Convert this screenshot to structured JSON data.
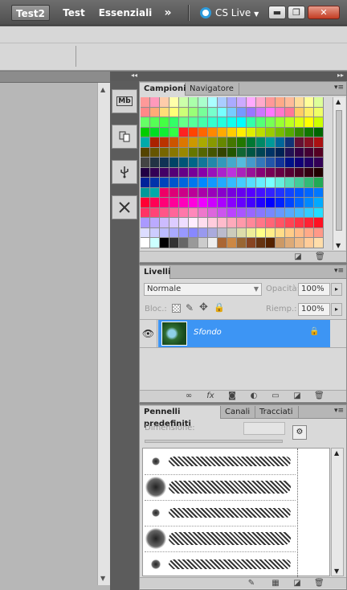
{
  "workspace_tabs": [
    "Test2",
    "Test",
    "Essenziali"
  ],
  "more_workspaces_glyph": "»",
  "cslive": {
    "label": "CS Live",
    "icon": "cs-live-ring-icon"
  },
  "window_buttons": {
    "minimize": "▬",
    "restore": "❐",
    "close": "✕"
  },
  "dock_collapse_glyph": "◂◂",
  "swatches_panel": {
    "tabs": [
      "Campioni",
      "Navigatore"
    ],
    "menu_glyph": "▾≡",
    "colors": [
      [
        "#ff9999",
        "#ff99bb",
        "#ffccaa",
        "#ffffaa",
        "#ccffaa",
        "#aaffaa",
        "#aaffcc",
        "#aaffff",
        "#aaccff",
        "#aaaaff",
        "#ccaaff",
        "#ffaaff",
        "#ffaacc",
        "#ff9999",
        "#ffaa88",
        "#ffbb99",
        "#ffdd99",
        "#ffff99",
        "#ddff99"
      ],
      [
        "#ff8888",
        "#ffaa77",
        "#ffdd77",
        "#ffff77",
        "#ccff77",
        "#99ff77",
        "#77ff99",
        "#77ffcc",
        "#77ffff",
        "#77ccff",
        "#7799ff",
        "#9977ff",
        "#cc77ff",
        "#ff77ff",
        "#ff77cc",
        "#ff7799",
        "#ffcc66",
        "#ffee66",
        "#eeff66"
      ],
      [
        "#66ff66",
        "#55ff55",
        "#44ff44",
        "#33ff66",
        "#66ff88",
        "#55ff99",
        "#44ffaa",
        "#33ffcc",
        "#22ffdd",
        "#11ffee",
        "#00ffff",
        "#33ffaa",
        "#55ff77",
        "#77ff55",
        "#99ff33",
        "#bbff22",
        "#ddff11",
        "#ffff00",
        "#ccff00"
      ],
      [
        "#00cc00",
        "#00dd22",
        "#11ee33",
        "#33ff44",
        "#ff2222",
        "#ff4400",
        "#ff6600",
        "#ff8800",
        "#ffaa00",
        "#ffcc00",
        "#ffee00",
        "#ddee00",
        "#bbdd00",
        "#99cc00",
        "#77bb00",
        "#55aa00",
        "#338800",
        "#117700",
        "#006600"
      ],
      [
        "#00aaaa",
        "#aa2200",
        "#bb3300",
        "#cc5500",
        "#dd7700",
        "#cc9900",
        "#aaaa00",
        "#889900",
        "#668800",
        "#447700",
        "#227700",
        "#007733",
        "#008866",
        "#009999",
        "#006699",
        "#113377",
        "#661133",
        "#881122",
        "#aa1111"
      ],
      [
        "#554400",
        "#665500",
        "#776600",
        "#887700",
        "#998800",
        "#667700",
        "#556600",
        "#445500",
        "#334400",
        "#225500",
        "#116633",
        "#005544",
        "#004455",
        "#003366",
        "#002255",
        "#221155",
        "#330044",
        "#440033",
        "#550022"
      ],
      [
        "#444444",
        "#223344",
        "#113355",
        "#004466",
        "#005577",
        "#006688",
        "#117799",
        "#2288aa",
        "#3399bb",
        "#44aacc",
        "#55bbdd",
        "#4499cc",
        "#3377bb",
        "#2255aa",
        "#113399",
        "#001188",
        "#110077",
        "#220066",
        "#330055"
      ],
      [
        "#220044",
        "#330055",
        "#440066",
        "#550077",
        "#660088",
        "#770099",
        "#8800aa",
        "#9911bb",
        "#aa22cc",
        "#bb33dd",
        "#aa22bb",
        "#991199",
        "#880077",
        "#770055",
        "#660044",
        "#550033",
        "#440022",
        "#330011",
        "#220000"
      ],
      [
        "#002299",
        "#0033aa",
        "#0044bb",
        "#0055cc",
        "#0066dd",
        "#0077ee",
        "#0088ff",
        "#1199ff",
        "#22aaff",
        "#33bbff",
        "#44ccff",
        "#55ddff",
        "#66eeff",
        "#77ffff",
        "#66eedd",
        "#55ddbb",
        "#44cc99",
        "#33bb77",
        "#22aa55"
      ],
      [
        "#009999",
        "#00aaaa",
        "#ee0066",
        "#dd0077",
        "#cc0088",
        "#bb0099",
        "#aa00aa",
        "#9900bb",
        "#8800cc",
        "#7700dd",
        "#6600ee",
        "#5500ff",
        "#4411ff",
        "#3322ff",
        "#2233ff",
        "#1144ff",
        "#0055ff",
        "#0066ff",
        "#0077ff"
      ],
      [
        "#ff0033",
        "#ff0055",
        "#ff0077",
        "#ff0099",
        "#ff00bb",
        "#ff00dd",
        "#ee00ff",
        "#cc00ff",
        "#aa00ff",
        "#8800ff",
        "#6600ff",
        "#4400ff",
        "#2200ff",
        "#0000ff",
        "#0022ff",
        "#0044ff",
        "#0066ff",
        "#0088ff",
        "#00aaff"
      ],
      [
        "#ff3366",
        "#ff4477",
        "#ff5588",
        "#ff6699",
        "#ff77aa",
        "#ff88bb",
        "#ee77cc",
        "#dd66dd",
        "#cc55ee",
        "#bb44ff",
        "#aa55ff",
        "#9966ff",
        "#8877ff",
        "#7788ff",
        "#6699ff",
        "#55aaff",
        "#44bbff",
        "#33ccff",
        "#22ddff"
      ],
      [
        "#aa99ff",
        "#bbaaff",
        "#ccbbff",
        "#ddccff",
        "#eeddff",
        "#ffeeff",
        "#ffddee",
        "#ffccdd",
        "#ffbbcc",
        "#ffaabb",
        "#ff99aa",
        "#ff8899",
        "#ff7788",
        "#ff6677",
        "#ff5566",
        "#ff4455",
        "#ff3344",
        "#ff2233",
        "#ff1122"
      ],
      [
        "#ddddff",
        "#ccccff",
        "#bbbbff",
        "#aaaaff",
        "#9999ff",
        "#8888ff",
        "#9999ee",
        "#aaaadd",
        "#bbbbcc",
        "#ccccbb",
        "#ddddaa",
        "#eeee99",
        "#ffff88",
        "#ffee88",
        "#ffdd88",
        "#ffcc88",
        "#ffbb88",
        "#ffaa88",
        "#ff9988"
      ],
      [
        "#ffffff",
        "#ccffff",
        "#000000",
        "#333333",
        "#666666",
        "#999999",
        "#cccccc",
        "#eeeeee",
        "#aa6633",
        "#cc8844",
        "#996633",
        "#884422",
        "#663311",
        "#552200",
        "#cc9966",
        "#ddaa77",
        "#eebb88",
        "#ffcc99",
        "#ffddaa"
      ]
    ]
  },
  "layers_panel": {
    "tab": "Livelli",
    "menu_glyph": "▾≡",
    "blend_mode": "Normale",
    "opacity_label": "Opacità:",
    "opacity_value": "100%",
    "lock_label": "Bloc.:",
    "fill_label": "Riemp.:",
    "fill_value": "100%",
    "layers": [
      {
        "name": "Sfondo",
        "visible_icon": "eye-icon",
        "lock_icon": "lock-icon"
      }
    ],
    "footer_icons": [
      "link-icon",
      "fx-icon",
      "mask-icon",
      "adjustment-icon",
      "folder-icon",
      "new-layer-icon",
      "trash-icon"
    ],
    "fx_glyph": "fx"
  },
  "brushes_panel": {
    "tabs": [
      "Pennelli predefiniti",
      "Canali",
      "Tracciati"
    ],
    "menu_glyph": "▾≡",
    "dimension_label": "Dimensione:",
    "brush_count": 5
  }
}
